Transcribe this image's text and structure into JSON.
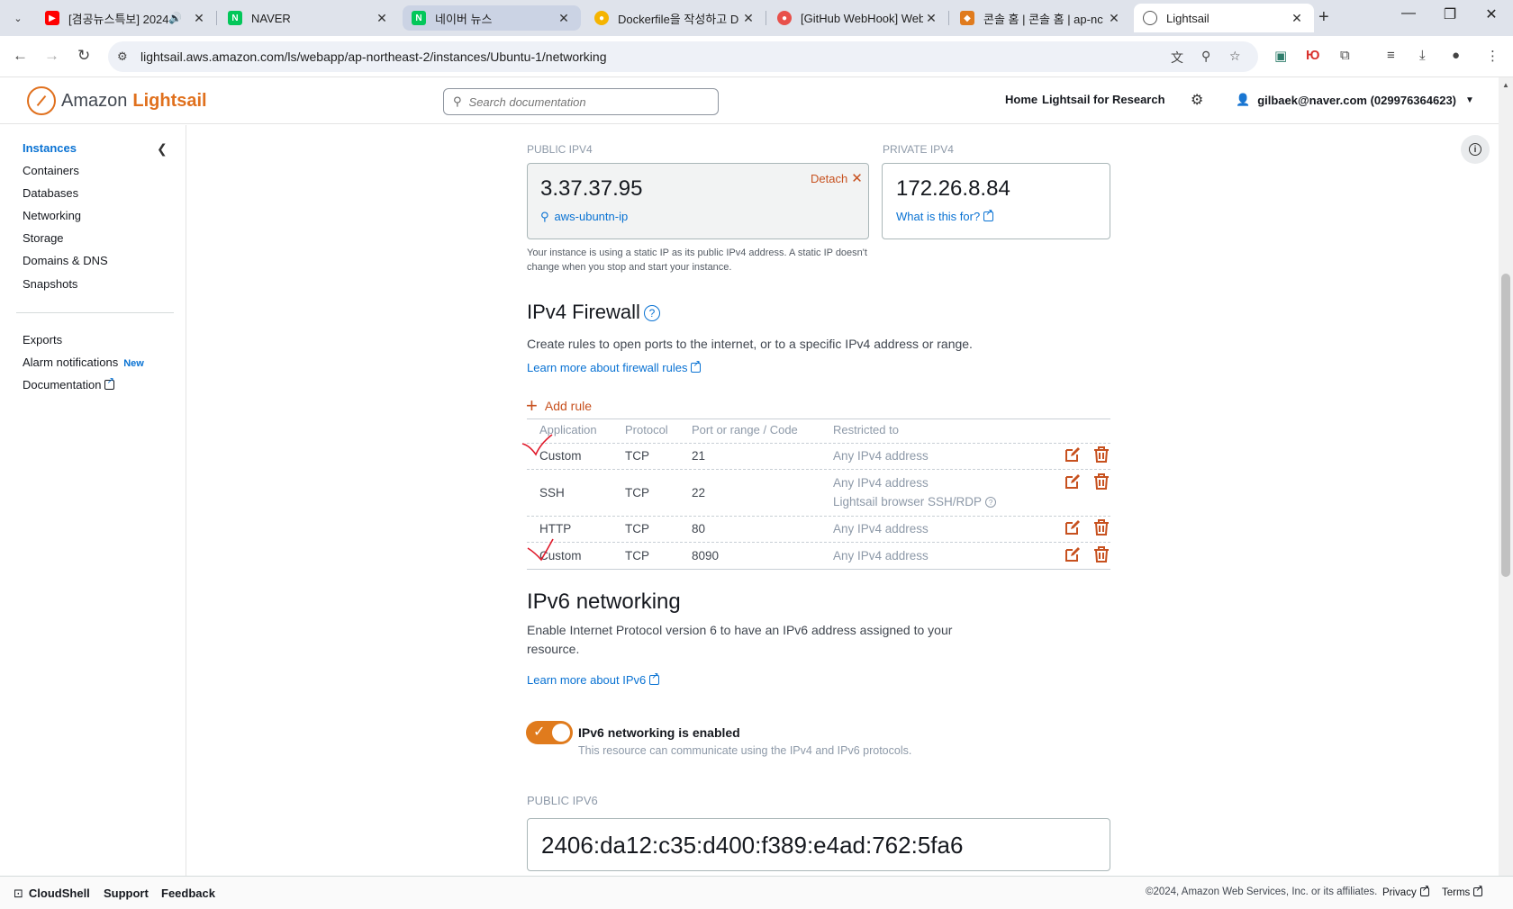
{
  "browser": {
    "tabs": [
      {
        "title": "[겸공뉴스특보] 2024",
        "favicon": "youtube",
        "color": "#ff0000",
        "audio": true
      },
      {
        "title": "NAVER",
        "favicon": "naver",
        "color": "#03c75a"
      },
      {
        "title": "네이버 뉴스",
        "favicon": "naver",
        "color": "#03c75a"
      },
      {
        "title": "Dockerfile을 작성하고 D",
        "favicon": "docs",
        "color": "#f5b400"
      },
      {
        "title": "[GitHub WebHook] Web",
        "favicon": "velog",
        "color": "#e8514b"
      },
      {
        "title": "콘솔 홈 | 콘솔 홈 | ap-nc",
        "favicon": "aws",
        "color": "#e07b1d"
      },
      {
        "title": "Lightsail",
        "favicon": "globe",
        "color": "#555555",
        "active": true
      }
    ],
    "url": "lightsail.aws.amazon.com/ls/webapp/ap-northeast-2/instances/Ubuntu-1/networking",
    "profile_initial": "Ю"
  },
  "header": {
    "logo_amazon": "Amazon",
    "logo_product": "Lightsail",
    "search_placeholder": "Search documentation",
    "nav_home": "Home",
    "nav_research": "Lightsail for Research",
    "account": "gilbaek@naver.com (029976364623)"
  },
  "sidebar": {
    "primary": [
      "Instances",
      "Containers",
      "Databases",
      "Networking",
      "Storage",
      "Domains & DNS",
      "Snapshots"
    ],
    "secondary": [
      "Exports",
      "Alarm notifications",
      "Documentation"
    ],
    "new_badge": "New"
  },
  "ipv4": {
    "public_label": "PUBLIC IPV4",
    "public_ip": "3.37.37.95",
    "static_ip_name": "aws-ubuntn-ip",
    "detach_label": "Detach",
    "private_label": "PRIVATE IPV4",
    "private_ip": "172.26.8.84",
    "what_link": "What is this for?",
    "note": "Your instance is using a static IP as its public IPv4 address. A static IP doesn't change when you stop and start your instance."
  },
  "firewall": {
    "title": "IPv4 Firewall",
    "description": "Create rules to open ports to the internet, or to a specific IPv4 address or range.",
    "learn_link": "Learn more about firewall rules",
    "add_rule": "Add rule",
    "columns": [
      "Application",
      "Protocol",
      "Port or range / Code",
      "Restricted to"
    ],
    "rules": [
      {
        "app": "Custom",
        "protocol": "TCP",
        "port": "21",
        "restricted": "Any IPv4 address",
        "extra": ""
      },
      {
        "app": "SSH",
        "protocol": "TCP",
        "port": "22",
        "restricted": "Any IPv4 address",
        "extra": "Lightsail browser SSH/RDP"
      },
      {
        "app": "HTTP",
        "protocol": "TCP",
        "port": "80",
        "restricted": "Any IPv4 address",
        "extra": ""
      },
      {
        "app": "Custom",
        "protocol": "TCP",
        "port": "8090",
        "restricted": "Any IPv4 address",
        "extra": ""
      }
    ]
  },
  "ipv6": {
    "title": "IPv6 networking",
    "description": "Enable Internet Protocol version 6 to have an IPv6 address assigned to your resource.",
    "learn_link": "Learn more about IPv6",
    "toggle_title": "IPv6 networking is enabled",
    "toggle_desc": "This resource can communicate using the IPv4 and IPv6 protocols.",
    "enabled": true,
    "public_label": "PUBLIC IPV6",
    "public_ip": "2406:da12:c35:d400:f389:e4ad:762:5fa6"
  },
  "footer": {
    "cloudshell": "CloudShell",
    "support": "Support",
    "feedback": "Feedback",
    "copyright": "©2024, Amazon Web Services, Inc. or its affiliates.",
    "privacy": "Privacy",
    "terms": "Terms"
  },
  "colors": {
    "accent": "#e07b1d",
    "link": "#0972d3",
    "action_orange": "#c7511f",
    "annotation_ink": "#e0192a"
  }
}
